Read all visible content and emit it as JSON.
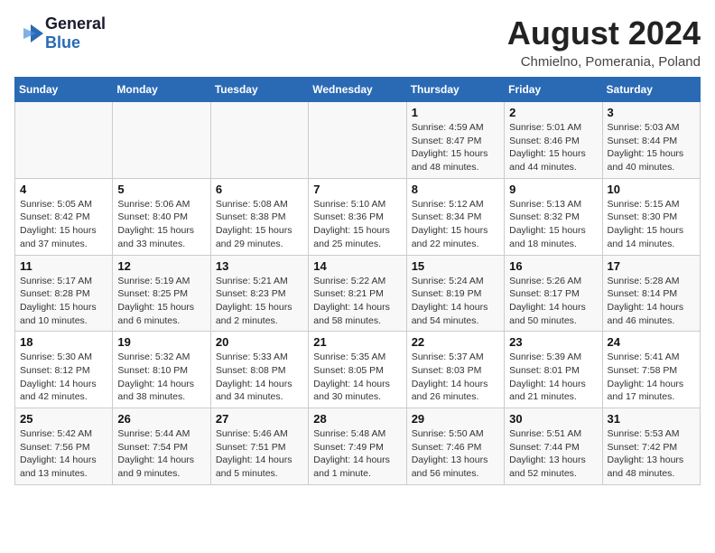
{
  "header": {
    "logo_general": "General",
    "logo_blue": "Blue",
    "title": "August 2024",
    "subtitle": "Chmielno, Pomerania, Poland"
  },
  "calendar": {
    "columns": [
      "Sunday",
      "Monday",
      "Tuesday",
      "Wednesday",
      "Thursday",
      "Friday",
      "Saturday"
    ],
    "rows": [
      [
        {
          "day": "",
          "info": ""
        },
        {
          "day": "",
          "info": ""
        },
        {
          "day": "",
          "info": ""
        },
        {
          "day": "",
          "info": ""
        },
        {
          "day": "1",
          "info": "Sunrise: 4:59 AM\nSunset: 8:47 PM\nDaylight: 15 hours\nand 48 minutes."
        },
        {
          "day": "2",
          "info": "Sunrise: 5:01 AM\nSunset: 8:46 PM\nDaylight: 15 hours\nand 44 minutes."
        },
        {
          "day": "3",
          "info": "Sunrise: 5:03 AM\nSunset: 8:44 PM\nDaylight: 15 hours\nand 40 minutes."
        }
      ],
      [
        {
          "day": "4",
          "info": "Sunrise: 5:05 AM\nSunset: 8:42 PM\nDaylight: 15 hours\nand 37 minutes."
        },
        {
          "day": "5",
          "info": "Sunrise: 5:06 AM\nSunset: 8:40 PM\nDaylight: 15 hours\nand 33 minutes."
        },
        {
          "day": "6",
          "info": "Sunrise: 5:08 AM\nSunset: 8:38 PM\nDaylight: 15 hours\nand 29 minutes."
        },
        {
          "day": "7",
          "info": "Sunrise: 5:10 AM\nSunset: 8:36 PM\nDaylight: 15 hours\nand 25 minutes."
        },
        {
          "day": "8",
          "info": "Sunrise: 5:12 AM\nSunset: 8:34 PM\nDaylight: 15 hours\nand 22 minutes."
        },
        {
          "day": "9",
          "info": "Sunrise: 5:13 AM\nSunset: 8:32 PM\nDaylight: 15 hours\nand 18 minutes."
        },
        {
          "day": "10",
          "info": "Sunrise: 5:15 AM\nSunset: 8:30 PM\nDaylight: 15 hours\nand 14 minutes."
        }
      ],
      [
        {
          "day": "11",
          "info": "Sunrise: 5:17 AM\nSunset: 8:28 PM\nDaylight: 15 hours\nand 10 minutes."
        },
        {
          "day": "12",
          "info": "Sunrise: 5:19 AM\nSunset: 8:25 PM\nDaylight: 15 hours\nand 6 minutes."
        },
        {
          "day": "13",
          "info": "Sunrise: 5:21 AM\nSunset: 8:23 PM\nDaylight: 15 hours\nand 2 minutes."
        },
        {
          "day": "14",
          "info": "Sunrise: 5:22 AM\nSunset: 8:21 PM\nDaylight: 14 hours\nand 58 minutes."
        },
        {
          "day": "15",
          "info": "Sunrise: 5:24 AM\nSunset: 8:19 PM\nDaylight: 14 hours\nand 54 minutes."
        },
        {
          "day": "16",
          "info": "Sunrise: 5:26 AM\nSunset: 8:17 PM\nDaylight: 14 hours\nand 50 minutes."
        },
        {
          "day": "17",
          "info": "Sunrise: 5:28 AM\nSunset: 8:14 PM\nDaylight: 14 hours\nand 46 minutes."
        }
      ],
      [
        {
          "day": "18",
          "info": "Sunrise: 5:30 AM\nSunset: 8:12 PM\nDaylight: 14 hours\nand 42 minutes."
        },
        {
          "day": "19",
          "info": "Sunrise: 5:32 AM\nSunset: 8:10 PM\nDaylight: 14 hours\nand 38 minutes."
        },
        {
          "day": "20",
          "info": "Sunrise: 5:33 AM\nSunset: 8:08 PM\nDaylight: 14 hours\nand 34 minutes."
        },
        {
          "day": "21",
          "info": "Sunrise: 5:35 AM\nSunset: 8:05 PM\nDaylight: 14 hours\nand 30 minutes."
        },
        {
          "day": "22",
          "info": "Sunrise: 5:37 AM\nSunset: 8:03 PM\nDaylight: 14 hours\nand 26 minutes."
        },
        {
          "day": "23",
          "info": "Sunrise: 5:39 AM\nSunset: 8:01 PM\nDaylight: 14 hours\nand 21 minutes."
        },
        {
          "day": "24",
          "info": "Sunrise: 5:41 AM\nSunset: 7:58 PM\nDaylight: 14 hours\nand 17 minutes."
        }
      ],
      [
        {
          "day": "25",
          "info": "Sunrise: 5:42 AM\nSunset: 7:56 PM\nDaylight: 14 hours\nand 13 minutes."
        },
        {
          "day": "26",
          "info": "Sunrise: 5:44 AM\nSunset: 7:54 PM\nDaylight: 14 hours\nand 9 minutes."
        },
        {
          "day": "27",
          "info": "Sunrise: 5:46 AM\nSunset: 7:51 PM\nDaylight: 14 hours\nand 5 minutes."
        },
        {
          "day": "28",
          "info": "Sunrise: 5:48 AM\nSunset: 7:49 PM\nDaylight: 14 hours\nand 1 minute."
        },
        {
          "day": "29",
          "info": "Sunrise: 5:50 AM\nSunset: 7:46 PM\nDaylight: 13 hours\nand 56 minutes."
        },
        {
          "day": "30",
          "info": "Sunrise: 5:51 AM\nSunset: 7:44 PM\nDaylight: 13 hours\nand 52 minutes."
        },
        {
          "day": "31",
          "info": "Sunrise: 5:53 AM\nSunset: 7:42 PM\nDaylight: 13 hours\nand 48 minutes."
        }
      ]
    ]
  }
}
